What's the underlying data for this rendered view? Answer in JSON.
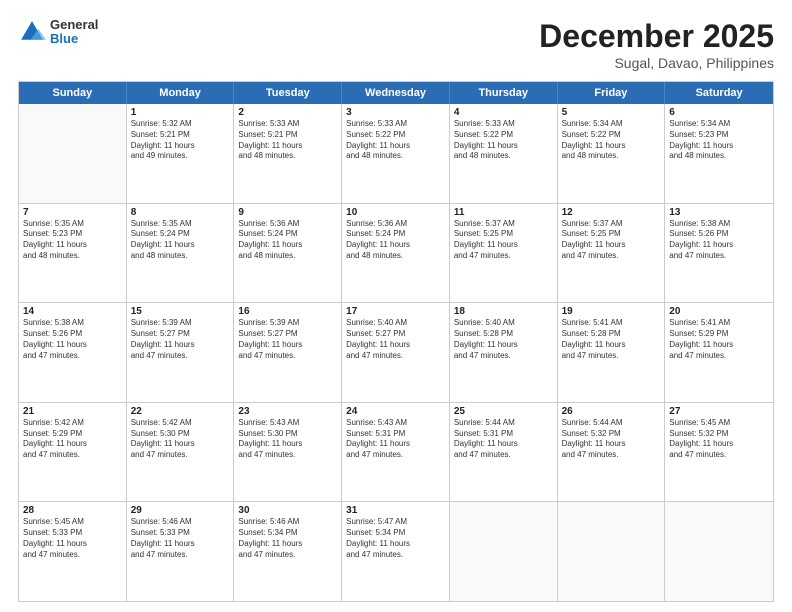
{
  "logo": {
    "general": "General",
    "blue": "Blue"
  },
  "header": {
    "month_year": "December 2025",
    "location": "Sugal, Davao, Philippines"
  },
  "weekdays": [
    "Sunday",
    "Monday",
    "Tuesday",
    "Wednesday",
    "Thursday",
    "Friday",
    "Saturday"
  ],
  "weeks": [
    [
      {
        "day": "",
        "lines": []
      },
      {
        "day": "1",
        "lines": [
          "Sunrise: 5:32 AM",
          "Sunset: 5:21 PM",
          "Daylight: 11 hours",
          "and 49 minutes."
        ]
      },
      {
        "day": "2",
        "lines": [
          "Sunrise: 5:33 AM",
          "Sunset: 5:21 PM",
          "Daylight: 11 hours",
          "and 48 minutes."
        ]
      },
      {
        "day": "3",
        "lines": [
          "Sunrise: 5:33 AM",
          "Sunset: 5:22 PM",
          "Daylight: 11 hours",
          "and 48 minutes."
        ]
      },
      {
        "day": "4",
        "lines": [
          "Sunrise: 5:33 AM",
          "Sunset: 5:22 PM",
          "Daylight: 11 hours",
          "and 48 minutes."
        ]
      },
      {
        "day": "5",
        "lines": [
          "Sunrise: 5:34 AM",
          "Sunset: 5:22 PM",
          "Daylight: 11 hours",
          "and 48 minutes."
        ]
      },
      {
        "day": "6",
        "lines": [
          "Sunrise: 5:34 AM",
          "Sunset: 5:23 PM",
          "Daylight: 11 hours",
          "and 48 minutes."
        ]
      }
    ],
    [
      {
        "day": "7",
        "lines": [
          "Sunrise: 5:35 AM",
          "Sunset: 5:23 PM",
          "Daylight: 11 hours",
          "and 48 minutes."
        ]
      },
      {
        "day": "8",
        "lines": [
          "Sunrise: 5:35 AM",
          "Sunset: 5:24 PM",
          "Daylight: 11 hours",
          "and 48 minutes."
        ]
      },
      {
        "day": "9",
        "lines": [
          "Sunrise: 5:36 AM",
          "Sunset: 5:24 PM",
          "Daylight: 11 hours",
          "and 48 minutes."
        ]
      },
      {
        "day": "10",
        "lines": [
          "Sunrise: 5:36 AM",
          "Sunset: 5:24 PM",
          "Daylight: 11 hours",
          "and 48 minutes."
        ]
      },
      {
        "day": "11",
        "lines": [
          "Sunrise: 5:37 AM",
          "Sunset: 5:25 PM",
          "Daylight: 11 hours",
          "and 47 minutes."
        ]
      },
      {
        "day": "12",
        "lines": [
          "Sunrise: 5:37 AM",
          "Sunset: 5:25 PM",
          "Daylight: 11 hours",
          "and 47 minutes."
        ]
      },
      {
        "day": "13",
        "lines": [
          "Sunrise: 5:38 AM",
          "Sunset: 5:26 PM",
          "Daylight: 11 hours",
          "and 47 minutes."
        ]
      }
    ],
    [
      {
        "day": "14",
        "lines": [
          "Sunrise: 5:38 AM",
          "Sunset: 5:26 PM",
          "Daylight: 11 hours",
          "and 47 minutes."
        ]
      },
      {
        "day": "15",
        "lines": [
          "Sunrise: 5:39 AM",
          "Sunset: 5:27 PM",
          "Daylight: 11 hours",
          "and 47 minutes."
        ]
      },
      {
        "day": "16",
        "lines": [
          "Sunrise: 5:39 AM",
          "Sunset: 5:27 PM",
          "Daylight: 11 hours",
          "and 47 minutes."
        ]
      },
      {
        "day": "17",
        "lines": [
          "Sunrise: 5:40 AM",
          "Sunset: 5:27 PM",
          "Daylight: 11 hours",
          "and 47 minutes."
        ]
      },
      {
        "day": "18",
        "lines": [
          "Sunrise: 5:40 AM",
          "Sunset: 5:28 PM",
          "Daylight: 11 hours",
          "and 47 minutes."
        ]
      },
      {
        "day": "19",
        "lines": [
          "Sunrise: 5:41 AM",
          "Sunset: 5:28 PM",
          "Daylight: 11 hours",
          "and 47 minutes."
        ]
      },
      {
        "day": "20",
        "lines": [
          "Sunrise: 5:41 AM",
          "Sunset: 5:29 PM",
          "Daylight: 11 hours",
          "and 47 minutes."
        ]
      }
    ],
    [
      {
        "day": "21",
        "lines": [
          "Sunrise: 5:42 AM",
          "Sunset: 5:29 PM",
          "Daylight: 11 hours",
          "and 47 minutes."
        ]
      },
      {
        "day": "22",
        "lines": [
          "Sunrise: 5:42 AM",
          "Sunset: 5:30 PM",
          "Daylight: 11 hours",
          "and 47 minutes."
        ]
      },
      {
        "day": "23",
        "lines": [
          "Sunrise: 5:43 AM",
          "Sunset: 5:30 PM",
          "Daylight: 11 hours",
          "and 47 minutes."
        ]
      },
      {
        "day": "24",
        "lines": [
          "Sunrise: 5:43 AM",
          "Sunset: 5:31 PM",
          "Daylight: 11 hours",
          "and 47 minutes."
        ]
      },
      {
        "day": "25",
        "lines": [
          "Sunrise: 5:44 AM",
          "Sunset: 5:31 PM",
          "Daylight: 11 hours",
          "and 47 minutes."
        ]
      },
      {
        "day": "26",
        "lines": [
          "Sunrise: 5:44 AM",
          "Sunset: 5:32 PM",
          "Daylight: 11 hours",
          "and 47 minutes."
        ]
      },
      {
        "day": "27",
        "lines": [
          "Sunrise: 5:45 AM",
          "Sunset: 5:32 PM",
          "Daylight: 11 hours",
          "and 47 minutes."
        ]
      }
    ],
    [
      {
        "day": "28",
        "lines": [
          "Sunrise: 5:45 AM",
          "Sunset: 5:33 PM",
          "Daylight: 11 hours",
          "and 47 minutes."
        ]
      },
      {
        "day": "29",
        "lines": [
          "Sunrise: 5:46 AM",
          "Sunset: 5:33 PM",
          "Daylight: 11 hours",
          "and 47 minutes."
        ]
      },
      {
        "day": "30",
        "lines": [
          "Sunrise: 5:46 AM",
          "Sunset: 5:34 PM",
          "Daylight: 11 hours",
          "and 47 minutes."
        ]
      },
      {
        "day": "31",
        "lines": [
          "Sunrise: 5:47 AM",
          "Sunset: 5:34 PM",
          "Daylight: 11 hours",
          "and 47 minutes."
        ]
      },
      {
        "day": "",
        "lines": []
      },
      {
        "day": "",
        "lines": []
      },
      {
        "day": "",
        "lines": []
      }
    ]
  ]
}
